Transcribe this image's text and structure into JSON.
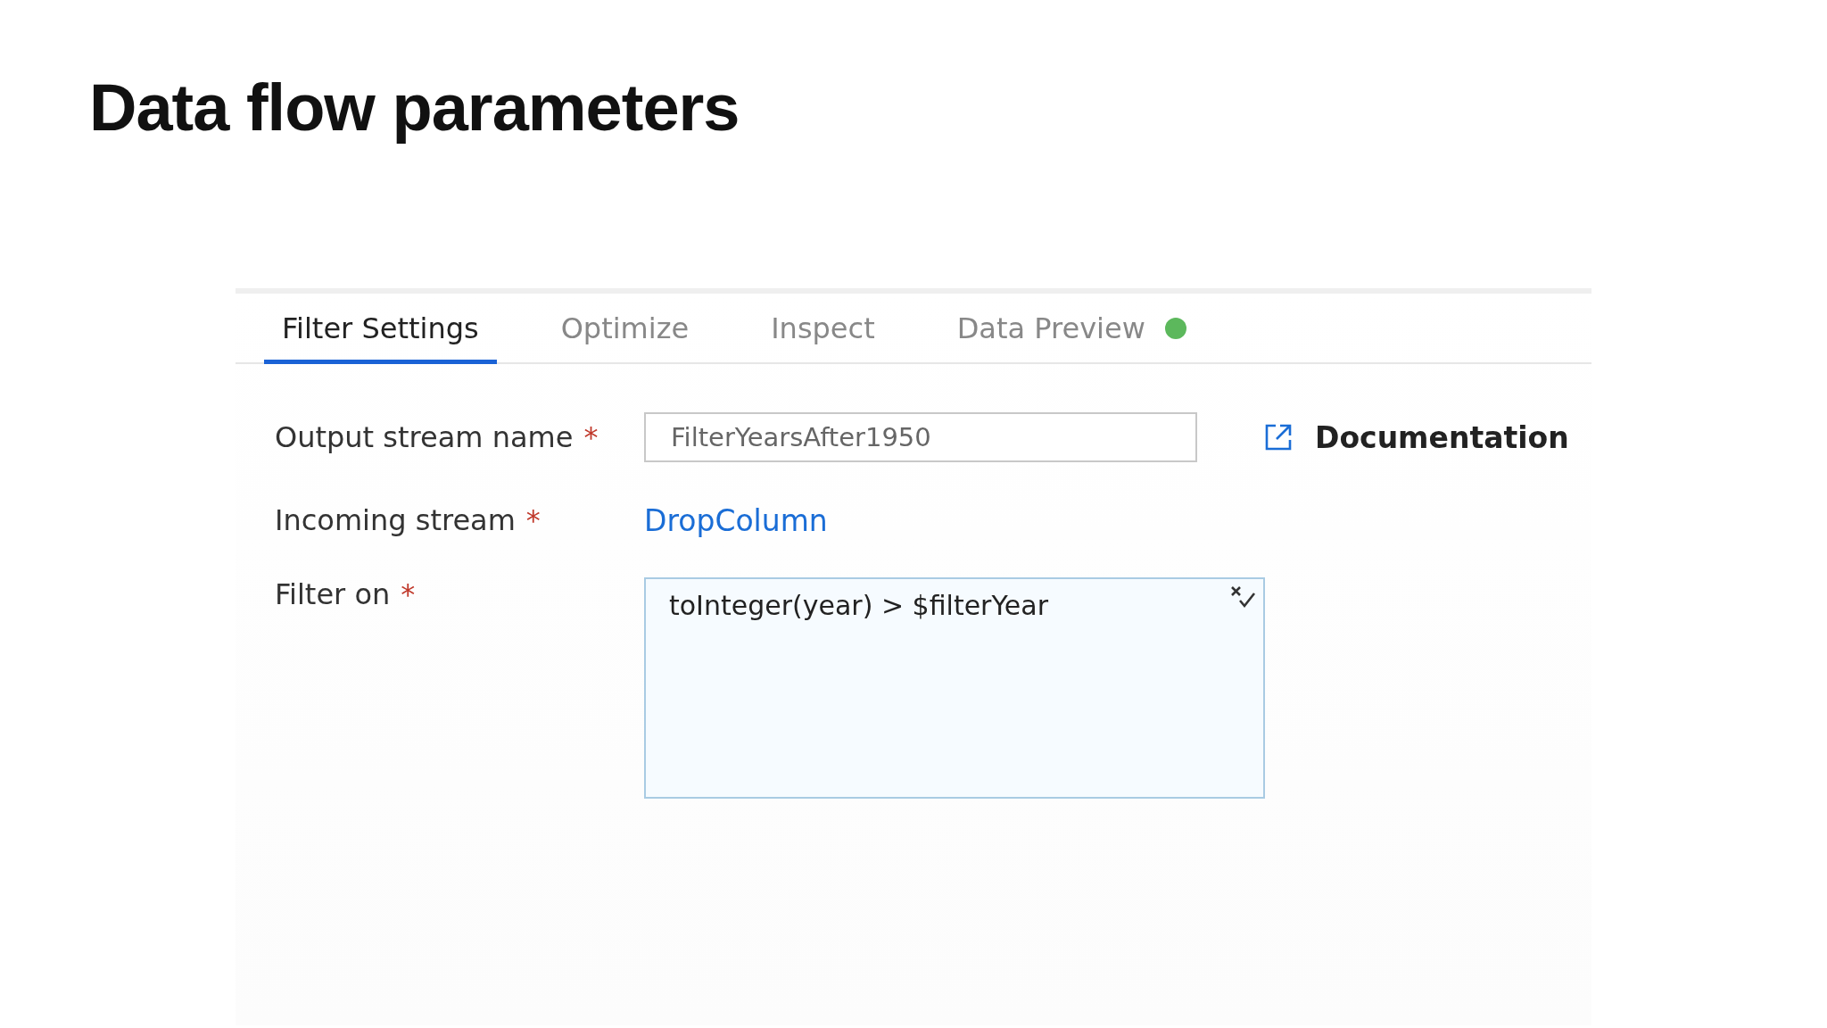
{
  "slide_title": "Data flow parameters",
  "tabs": [
    {
      "label": "Filter Settings",
      "selected": true
    },
    {
      "label": "Optimize",
      "selected": false
    },
    {
      "label": "Inspect",
      "selected": false
    },
    {
      "label": "Data Preview",
      "selected": false,
      "color": "#5cb85c"
    }
  ],
  "fields": [
    {
      "kind": "text-input",
      "label": "Output stream name",
      "required_mark": "*",
      "value": "FilterYearsAfter1950"
    },
    {
      "kind": "link",
      "label": "Incoming stream",
      "required_mark": "*",
      "value": "DropColumn"
    },
    {
      "kind": "expression",
      "label": "Filter on",
      "required_mark": "*",
      "value": "toInteger(year) > $filterYear"
    }
  ],
  "documentation_link": "Documentation"
}
